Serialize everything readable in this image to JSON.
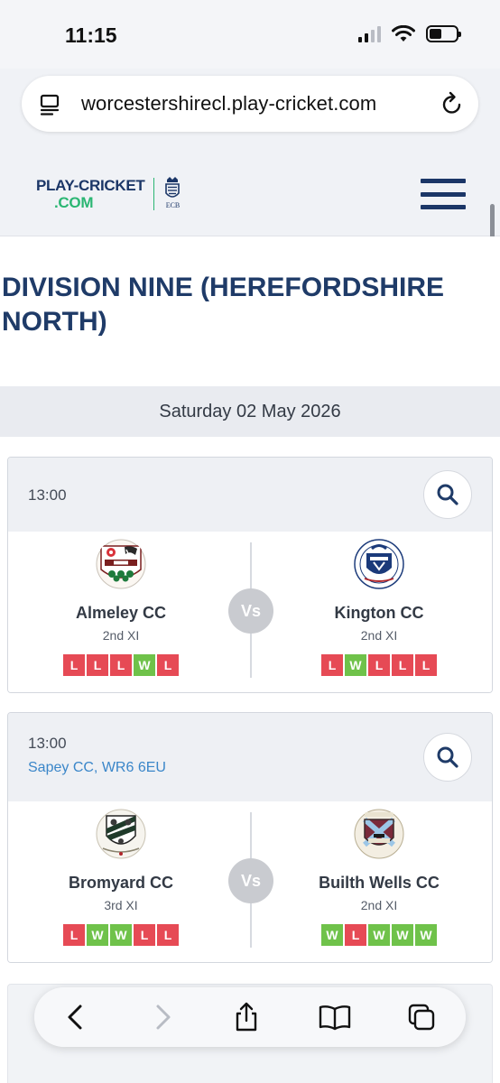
{
  "status_bar": {
    "time": "11:15"
  },
  "browser": {
    "url": "worcestershirecl.play-cricket.com"
  },
  "site": {
    "logo_line1": "PLAY-CRICKET",
    "logo_line2": ".COM",
    "ecb_label": "ECB"
  },
  "page": {
    "title": "DIVISION NINE (HEREFORDSHIRE NORTH)",
    "date": "Saturday 02 May 2026"
  },
  "vs_label": "Vs",
  "matches": [
    {
      "time": "13:00",
      "venue": "",
      "home": {
        "name": "Almeley CC",
        "xi": "2nd XI",
        "form": [
          "L",
          "L",
          "L",
          "W",
          "L"
        ]
      },
      "away": {
        "name": "Kington CC",
        "xi": "2nd XI",
        "form": [
          "L",
          "W",
          "L",
          "L",
          "L"
        ]
      }
    },
    {
      "time": "13:00",
      "venue": "Sapey CC, WR6 6EU",
      "home": {
        "name": "Bromyard CC",
        "xi": "3rd XI",
        "form": [
          "L",
          "W",
          "W",
          "L",
          "L"
        ]
      },
      "away": {
        "name": "Builth Wells CC",
        "xi": "2nd XI",
        "form": [
          "W",
          "L",
          "W",
          "W",
          "W"
        ]
      }
    }
  ],
  "colors": {
    "navy": "#1f3b68",
    "loss": "#e64a55",
    "win": "#6fc24a",
    "venue_link": "#3a86c9"
  }
}
